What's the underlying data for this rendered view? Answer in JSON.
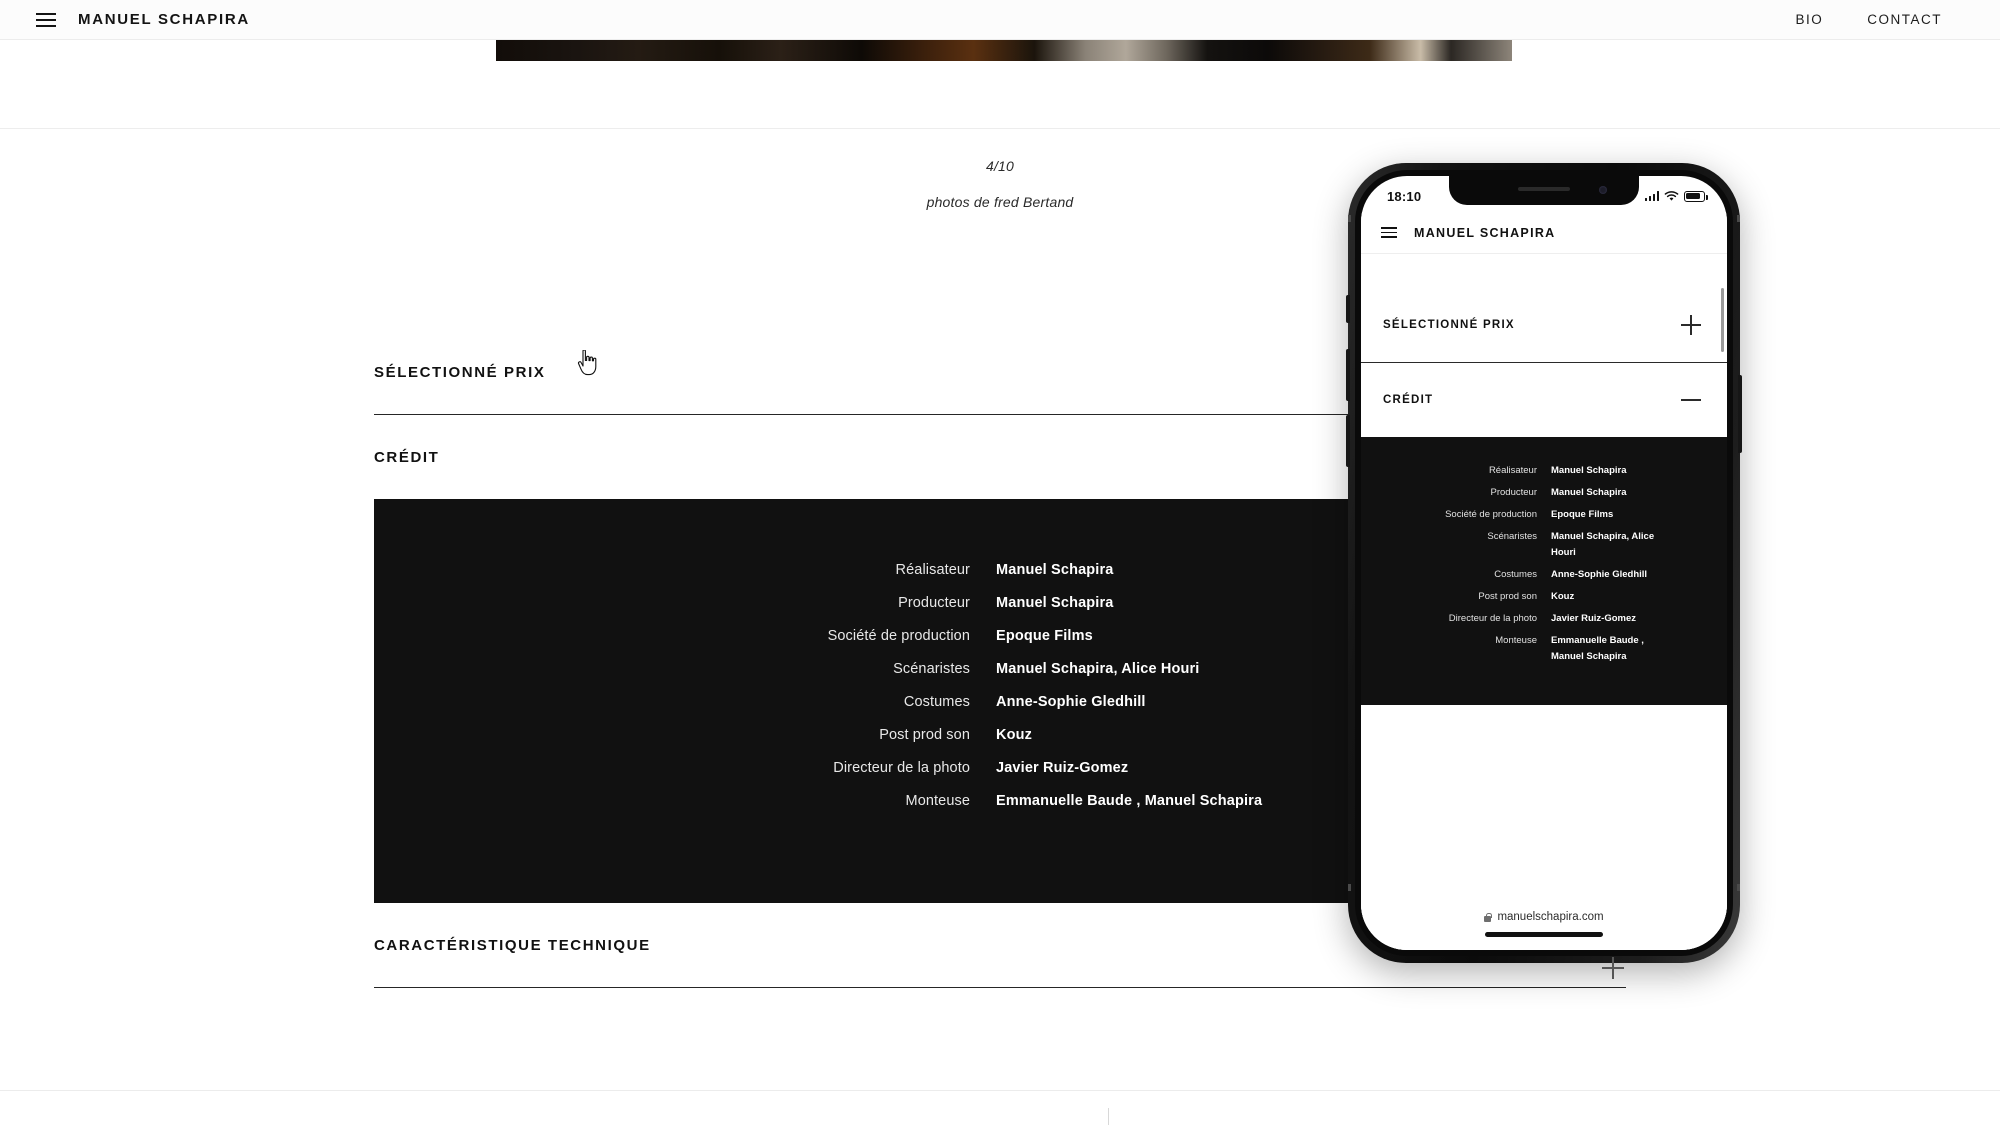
{
  "header": {
    "menu_icon": "hamburger-menu-icon",
    "brand": "MANUEL SCHAPIRA",
    "nav": [
      {
        "label": "BIO"
      },
      {
        "label": "CONTACT"
      }
    ]
  },
  "gallery": {
    "counter": "4/10",
    "caption": "photos de fred Bertand"
  },
  "sections": [
    {
      "title": "SÉLECTIONNÉ PRIX",
      "state": "collapsed"
    },
    {
      "title": "CRÉDIT",
      "state": "expanded"
    },
    {
      "title": "CARACTÉRISTIQUE TECHNIQUE",
      "state": "collapsed"
    }
  ],
  "credits": [
    {
      "label": "Réalisateur",
      "value": "Manuel Schapira"
    },
    {
      "label": "Producteur",
      "value": "Manuel Schapira"
    },
    {
      "label": "Société de production",
      "value": "Epoque Films"
    },
    {
      "label": "Scénaristes",
      "value": "Manuel Schapira, Alice Houri"
    },
    {
      "label": "Costumes",
      "value": "Anne-Sophie Gledhill"
    },
    {
      "label": "Post prod son",
      "value": "Kouz"
    },
    {
      "label": "Directeur de la photo",
      "value": "Javier Ruiz-Gomez"
    },
    {
      "label": "Monteuse",
      "value": "Emmanuelle Baude , Manuel Schapira"
    }
  ],
  "phone": {
    "status": {
      "time": "18:10",
      "signal_icon": "cellular-bars-icon",
      "wifi_icon": "wifi-icon",
      "battery_icon": "battery-icon"
    },
    "header": {
      "menu_icon": "hamburger-menu-icon",
      "brand": "MANUEL SCHAPIRA"
    },
    "sections": [
      {
        "title": "SÉLECTIONNÉ PRIX",
        "toggle_icon": "plus-icon"
      },
      {
        "title": "CRÉDIT",
        "toggle_icon": "minus-icon"
      }
    ],
    "credits": [
      {
        "label": "Réalisateur",
        "value": "Manuel Schapira"
      },
      {
        "label": "Producteur",
        "value": "Manuel Schapira"
      },
      {
        "label": "Société de production",
        "value": "Epoque Films"
      },
      {
        "label": "Scénaristes",
        "value": "Manuel Schapira, Alice Houri"
      },
      {
        "label": "Costumes",
        "value": "Anne-Sophie Gledhill"
      },
      {
        "label": "Post prod son",
        "value": "Kouz"
      },
      {
        "label": "Directeur de la photo",
        "value": "Javier Ruiz-Gomez"
      },
      {
        "label": "Monteuse",
        "value": "Emmanuelle Baude , Manuel Schapira"
      }
    ],
    "urlbar": {
      "lock_icon": "lock-icon",
      "url": "manuelschapira.com"
    }
  },
  "colors": {
    "page_bg": "#ffffff",
    "text": "#111111",
    "credit_panel_bg": "#111111",
    "credit_panel_text": "#ffffff",
    "divider": "#262626"
  }
}
